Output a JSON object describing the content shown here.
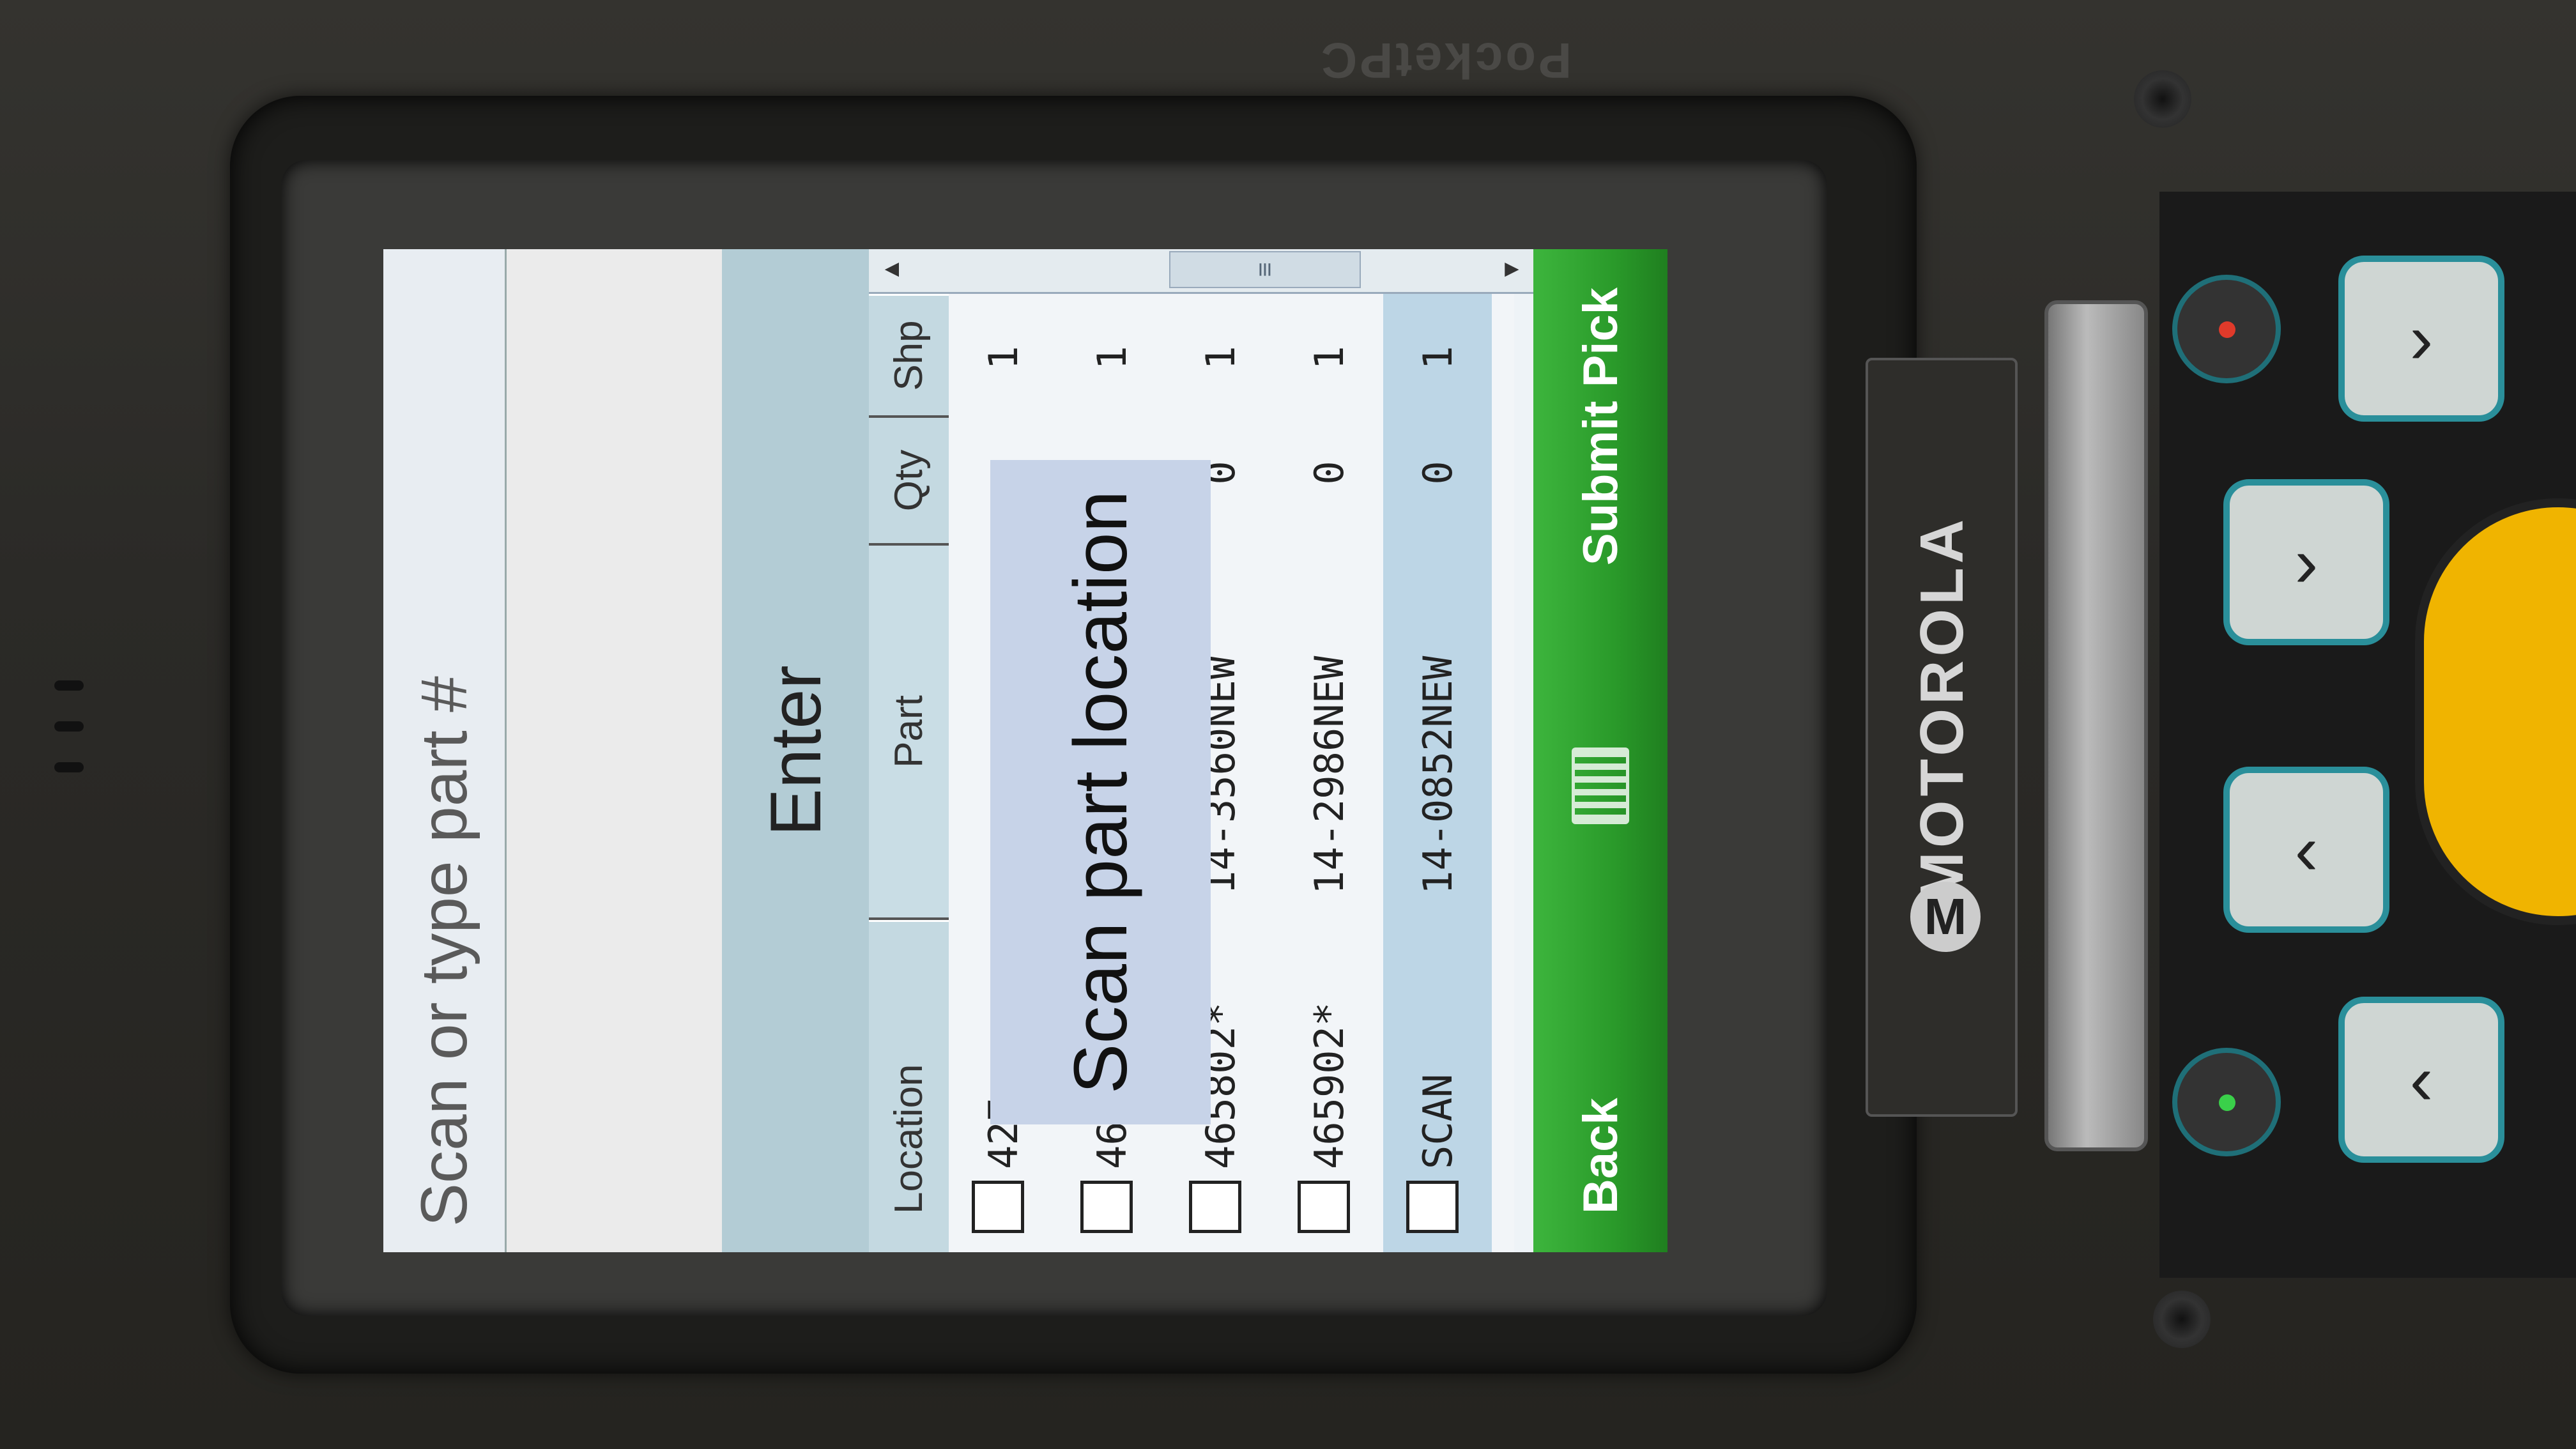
{
  "device": {
    "brand_top": "PocketPC",
    "brand_side": "MOTOROLA",
    "logo_letter": "M"
  },
  "app": {
    "prompt": "Scan or type part #",
    "input_value": "",
    "enter_label": "Enter",
    "columns": [
      "Location",
      "Part",
      "Qty",
      "Shp"
    ],
    "rows": [
      {
        "location": "427",
        "part": "",
        "qty": "",
        "shp": "1"
      },
      {
        "location": "463",
        "part": "",
        "qty": "",
        "shp": "1"
      },
      {
        "location": "465802*",
        "part": "14-3560NEW",
        "qty": "0",
        "shp": "1"
      },
      {
        "location": "465902*",
        "part": "14-2986NEW",
        "qty": "0",
        "shp": "1"
      },
      {
        "location": "SCAN",
        "part": "14-0852NEW",
        "qty": "0",
        "shp": "1"
      }
    ],
    "tooltip": "Scan part location",
    "menu": {
      "back": "Back",
      "submit": "Submit Pick"
    }
  },
  "colors": {
    "menubar": "#2a9a2a",
    "key_border": "#2a8f9a",
    "yellow_trigger": "#f0b400"
  }
}
